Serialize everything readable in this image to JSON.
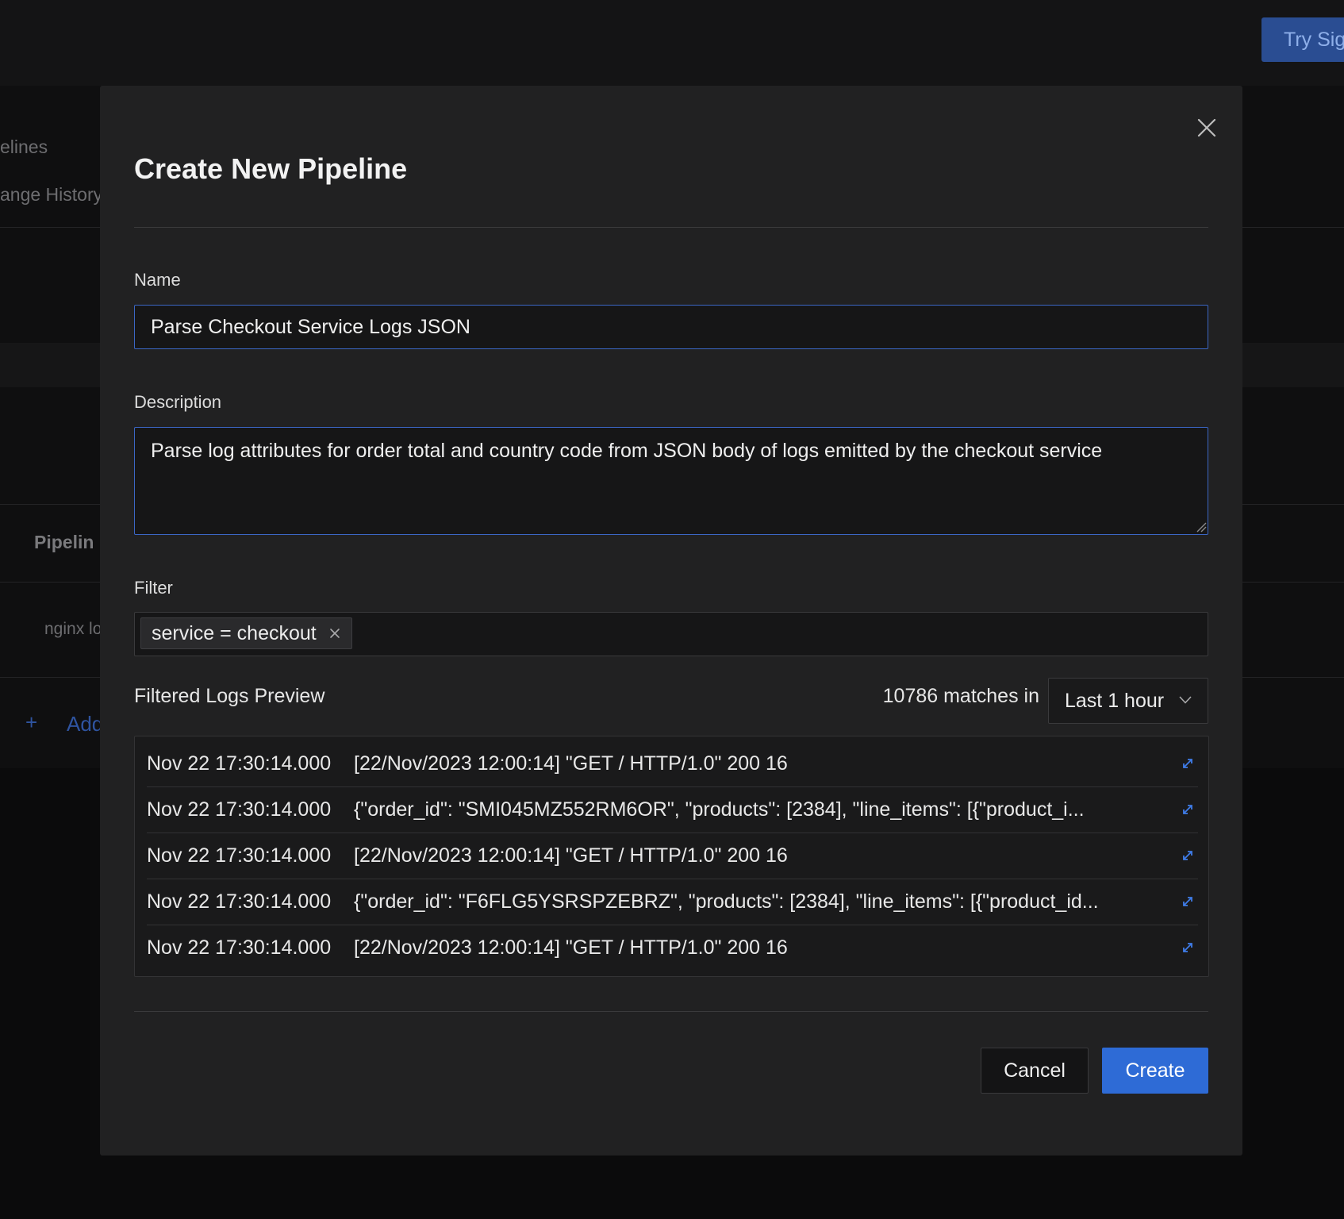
{
  "background": {
    "try_button": "Try Sig",
    "nav_pipelines": "elines",
    "nav_change_history": "ange History",
    "table_header_pipeline": "Pipelin",
    "row_nginx": "nginx lo",
    "add_plus": "+",
    "add_label": "Add"
  },
  "modal": {
    "title": "Create New Pipeline",
    "close_icon": "close-icon",
    "name_label": "Name",
    "name_value": "Parse Checkout Service Logs JSON",
    "description_label": "Description",
    "description_value": "Parse log attributes for order total and country code from JSON body of logs emitted by the checkout service",
    "filter_label": "Filter",
    "filter_chip": "service = checkout",
    "preview_title": "Filtered Logs Preview",
    "match_count": "10786 matches in",
    "time_range": "Last 1 hour",
    "logs": [
      {
        "time": "Nov 22 17:30:14.000",
        "message": "[22/Nov/2023 12:00:14] \"GET / HTTP/1.0\" 200 16"
      },
      {
        "time": "Nov 22 17:30:14.000",
        "message": "{\"order_id\": \"SMI045MZ552RM6OR\", \"products\": [2384], \"line_items\": [{\"product_i..."
      },
      {
        "time": "Nov 22 17:30:14.000",
        "message": "[22/Nov/2023 12:00:14] \"GET / HTTP/1.0\" 200 16"
      },
      {
        "time": "Nov 22 17:30:14.000",
        "message": "{\"order_id\": \"F6FLG5YSRSPZEBRZ\", \"products\": [2384], \"line_items\": [{\"product_id..."
      },
      {
        "time": "Nov 22 17:30:14.000",
        "message": "[22/Nov/2023 12:00:14] \"GET / HTTP/1.0\" 200 16"
      }
    ],
    "cancel_label": "Cancel",
    "create_label": "Create"
  },
  "colors": {
    "accent": "#2e6bd6",
    "modal_bg": "#212122",
    "input_focus_border": "#3b66c4",
    "expand_icon": "#3f7ce8"
  }
}
